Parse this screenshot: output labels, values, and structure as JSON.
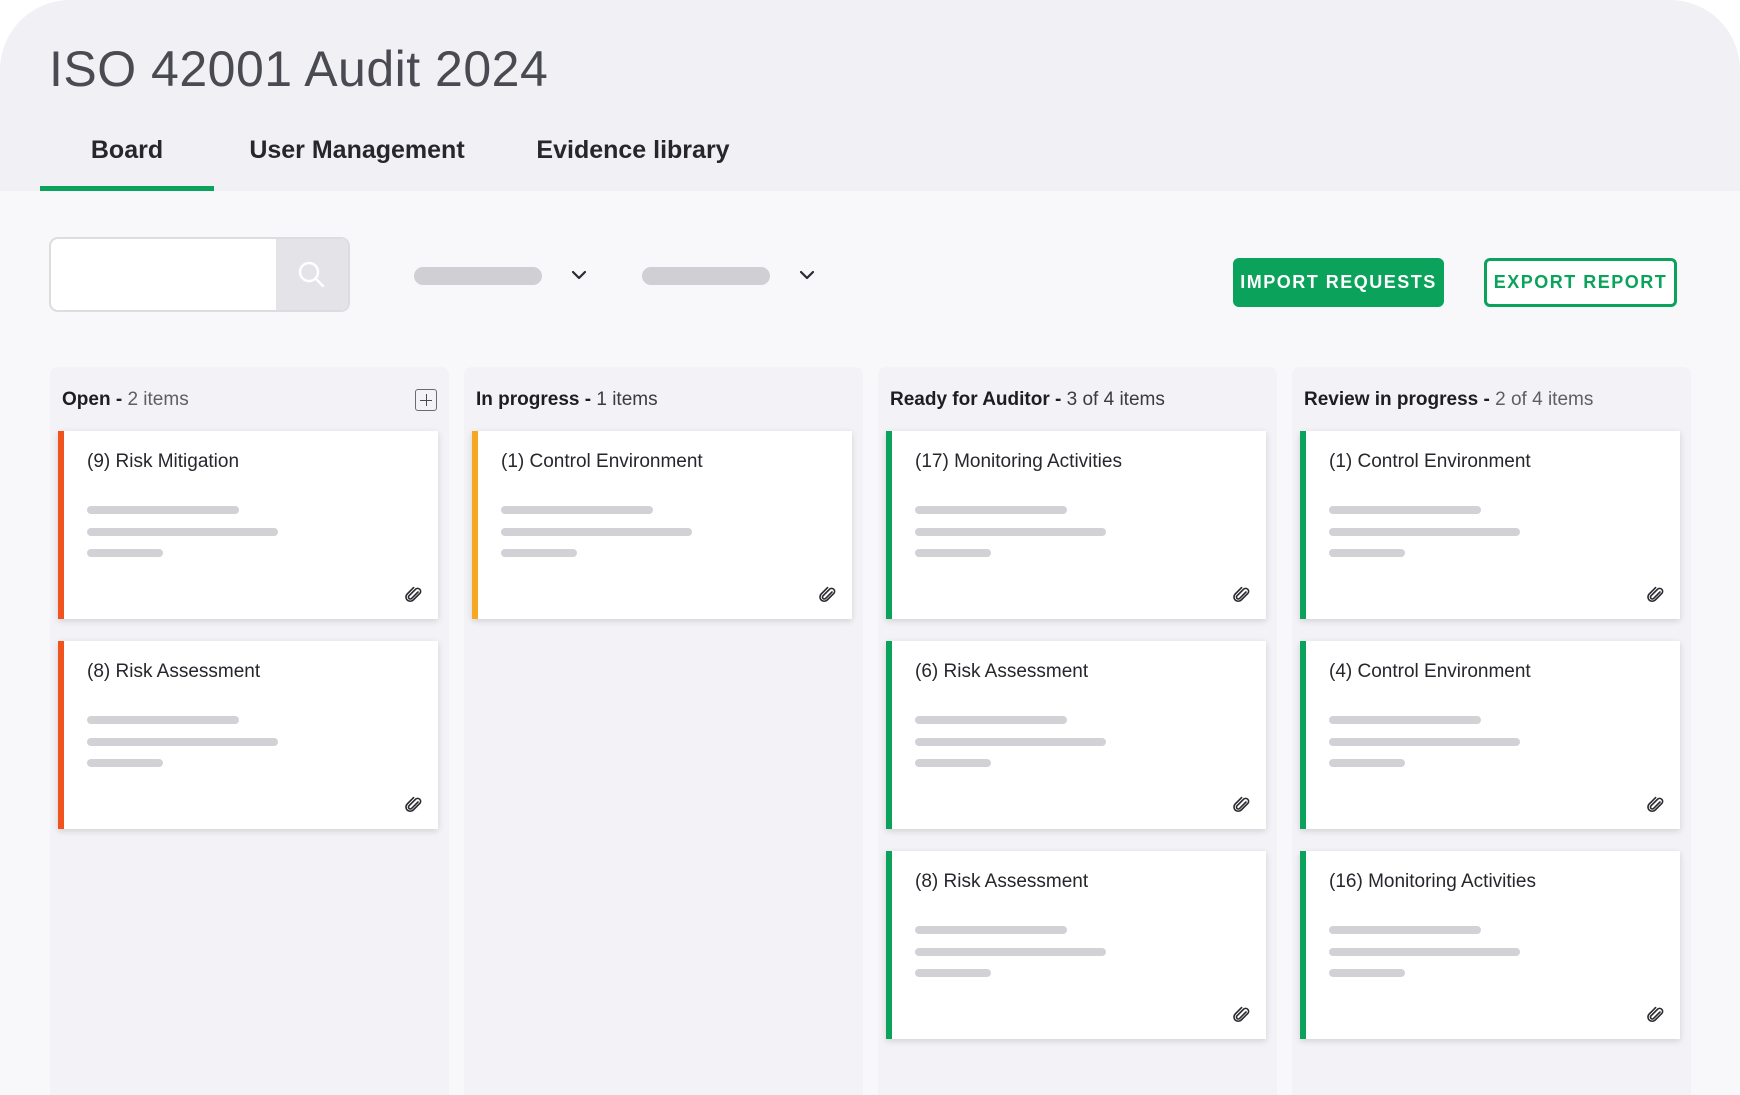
{
  "app": {
    "title": "ISO 42001 Audit 2024"
  },
  "tabs": [
    {
      "label": "Board",
      "active": true
    },
    {
      "label": "User Management",
      "active": false
    },
    {
      "label": "Evidence library",
      "active": false
    }
  ],
  "toolbar": {
    "search_value": "",
    "import_label": "IMPORT REQUESTS",
    "export_label": "EXPORT  REPORT"
  },
  "colors": {
    "accent": "#0ba35b",
    "status_open": "#f0531d",
    "status_in_progress": "#f7a823",
    "status_done": "#0ba35b"
  },
  "columns": [
    {
      "title": "Open -",
      "count": "2 items",
      "cards": [
        {
          "title": "(9) Risk Mitigation"
        },
        {
          "title": "(8) Risk Assessment"
        }
      ]
    },
    {
      "title": "In progress -",
      "count": "1 items",
      "cards": [
        {
          "title": "(1) Control Environment"
        }
      ]
    },
    {
      "title": "Ready for Auditor -",
      "count": "3 of 4 items",
      "cards": [
        {
          "title": "(17) Monitoring Activities"
        },
        {
          "title": "(6) Risk Assessment"
        },
        {
          "title": "(8) Risk Assessment"
        }
      ]
    },
    {
      "title": "Review in progress -",
      "count": "2 of 4 items",
      "cards": [
        {
          "title": "(1) Control Environment"
        },
        {
          "title": "(4) Control Environment"
        },
        {
          "title": "(16) Monitoring Activities"
        }
      ]
    }
  ]
}
